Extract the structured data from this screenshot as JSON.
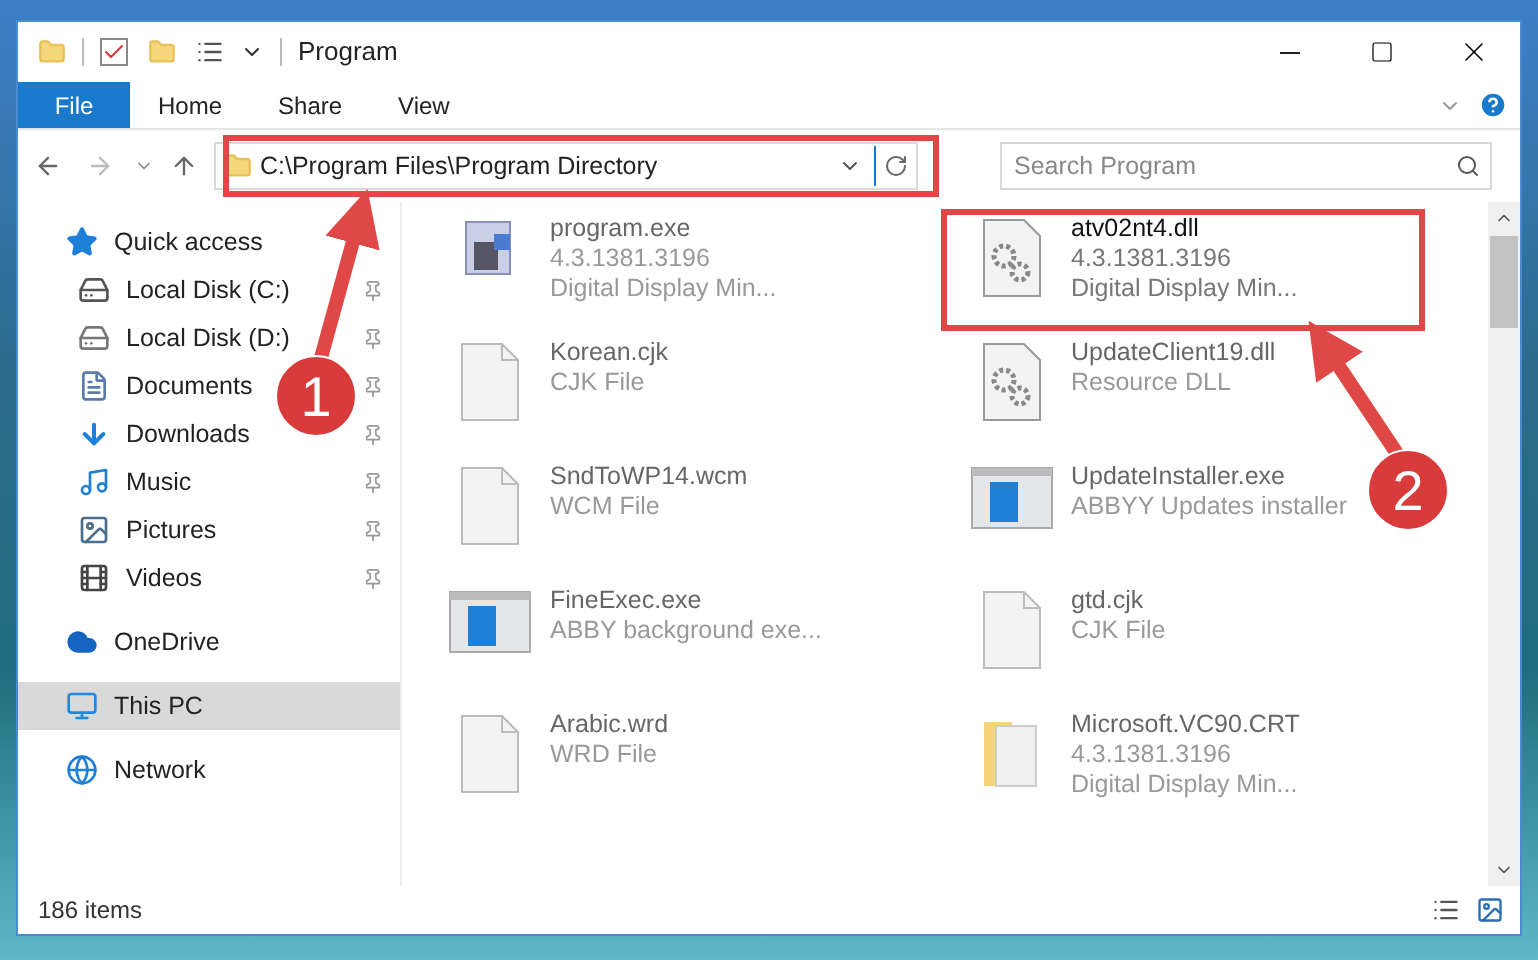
{
  "window": {
    "title": "Program"
  },
  "ribbon_tabs": [
    {
      "label": "File",
      "selected": true
    },
    {
      "label": "Home",
      "selected": false
    },
    {
      "label": "Share",
      "selected": false
    },
    {
      "label": "View",
      "selected": false
    }
  ],
  "address_bar": {
    "path": "C:\\Program Files\\Program Directory"
  },
  "search": {
    "placeholder": "Search Program"
  },
  "sidebar": {
    "items": [
      {
        "label": "Quick access",
        "selected": false,
        "children": [
          {
            "label": "Local Disk (C:)",
            "pinned": true,
            "selected": false
          },
          {
            "label": "Local Disk (D:)",
            "pinned": true,
            "selected": false
          },
          {
            "label": "Documents",
            "pinned": true,
            "selected": false
          },
          {
            "label": "Downloads",
            "pinned": true,
            "selected": false
          },
          {
            "label": "Music",
            "pinned": true,
            "selected": false
          },
          {
            "label": "Pictures",
            "pinned": true,
            "selected": false
          },
          {
            "label": "Videos",
            "pinned": true,
            "selected": false
          }
        ]
      },
      {
        "label": "OneDrive",
        "selected": false
      },
      {
        "label": "This PC",
        "selected": true
      },
      {
        "label": "Network",
        "selected": false
      }
    ]
  },
  "files": [
    {
      "name": "program.exe",
      "details": [
        "4.3.1381.3196",
        "Digital Display Min..."
      ],
      "kind": "app",
      "emphasized": false
    },
    {
      "name": "atv02nt4.dll",
      "details": [
        "4.3.1381.3196",
        "Digital Display Min..."
      ],
      "kind": "dll",
      "emphasized": true
    },
    {
      "name": "Korean.cjk",
      "details": [
        "CJK File"
      ],
      "kind": "blank",
      "emphasized": false
    },
    {
      "name": "UpdateClient19.dll",
      "details": [
        "Resource DLL"
      ],
      "kind": "dll",
      "emphasized": false
    },
    {
      "name": "SndToWP14.wcm",
      "details": [
        "WCM File"
      ],
      "kind": "blank",
      "emphasized": false
    },
    {
      "name": "UpdateInstaller.exe",
      "details": [
        "ABBYY Updates installer"
      ],
      "kind": "window",
      "emphasized": false
    },
    {
      "name": "FineExec.exe",
      "details": [
        "ABBY background exe..."
      ],
      "kind": "window",
      "emphasized": false
    },
    {
      "name": "gtd.cjk",
      "details": [
        "CJK File"
      ],
      "kind": "blank",
      "emphasized": false
    },
    {
      "name": "Arabic.wrd",
      "details": [
        "WRD File"
      ],
      "kind": "blank",
      "emphasized": false
    },
    {
      "name": "Microsoft.VC90.CRT",
      "details": [
        "4.3.1381.3196",
        "Digital Display Min..."
      ],
      "kind": "folder",
      "emphasized": false
    }
  ],
  "status_bar": {
    "count": "186 items"
  },
  "annotations": [
    {
      "label": "1"
    },
    {
      "label": "2"
    }
  ]
}
